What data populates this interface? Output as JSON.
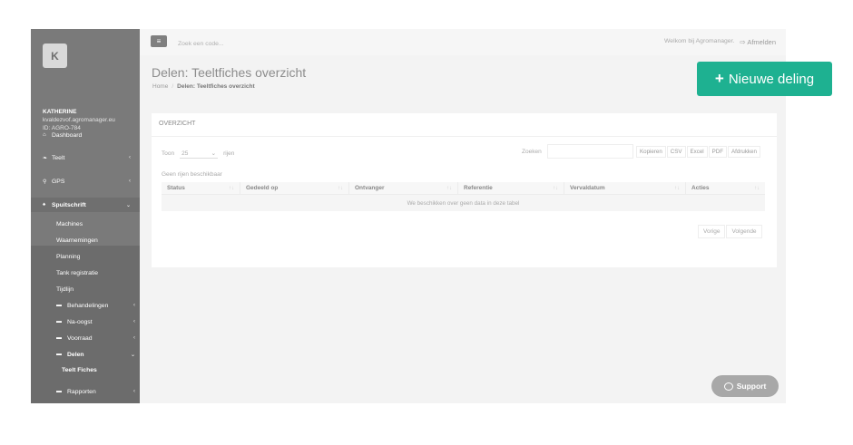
{
  "user": {
    "initial": "K",
    "name": "KATHERINE",
    "email": "kvaldezvof.agromanager.eu",
    "id": "ID: AGRO-784"
  },
  "sidebar": {
    "items": [
      {
        "label": "Dashboard",
        "icon": "dashboard-icon",
        "glyph": "⌂"
      },
      {
        "label": "Teelt",
        "icon": "leaf-icon",
        "glyph": "❧",
        "chev": "‹"
      },
      {
        "label": "GPS",
        "icon": "map-pin-icon",
        "glyph": "⚲",
        "chev": "‹"
      },
      {
        "label": "Spuitschrift",
        "icon": "sprayer-icon",
        "glyph": "♠",
        "chev": "⌄"
      }
    ],
    "submenu": [
      {
        "label": "Machines"
      },
      {
        "label": "Waarnemingen"
      },
      {
        "label": "Planning"
      },
      {
        "label": "Tank registratie"
      },
      {
        "label": "Tijdlijn"
      },
      {
        "label": "Behandelingen",
        "chev": "‹"
      },
      {
        "label": "Na-oogst",
        "chev": "‹"
      },
      {
        "label": "Voorraad",
        "chev": "‹"
      },
      {
        "label": "Delen",
        "chev": "⌄"
      },
      {
        "label": "Teelt Fiches"
      },
      {
        "label": "Rapporten",
        "chev": "‹"
      }
    ]
  },
  "topbar": {
    "menu_glyph": "≡",
    "search_placeholder": "Zoek een code...",
    "welcome": "Welkom bij Agromanager.",
    "logout_glyph": "⇨",
    "logout": "Afmelden"
  },
  "page": {
    "title": "Delen: Teeltfiches overzicht",
    "breadcrumb": {
      "home": "Home",
      "separator": "/",
      "current": "Delen: Teeltfiches overzicht"
    },
    "new_button": {
      "plus": "+",
      "label": "Nieuwe deling"
    }
  },
  "panel": {
    "title": "OVERZICHT",
    "length": {
      "show": "Toon",
      "value": "25",
      "arrow": "⌄",
      "suffix": "rijen"
    },
    "filter_label": "Zoeken",
    "export_buttons": [
      "Kopieren",
      "CSV",
      "Excel",
      "PDF",
      "Afdrukken"
    ],
    "info": "Geen rijen beschikbaar",
    "columns": [
      "Status",
      "Gedeeld op",
      "Ontvanger",
      "Referentie",
      "Vervaldatum",
      "Acties"
    ],
    "sort_glyph": "↑↓",
    "empty": "We beschikken over geen data in deze tabel",
    "pager": {
      "prev": "Vorige",
      "next": "Volgende"
    }
  },
  "support": {
    "label": "Support"
  },
  "colors": {
    "accent": "#1eb191",
    "sidebar": "#7a7a7a"
  }
}
